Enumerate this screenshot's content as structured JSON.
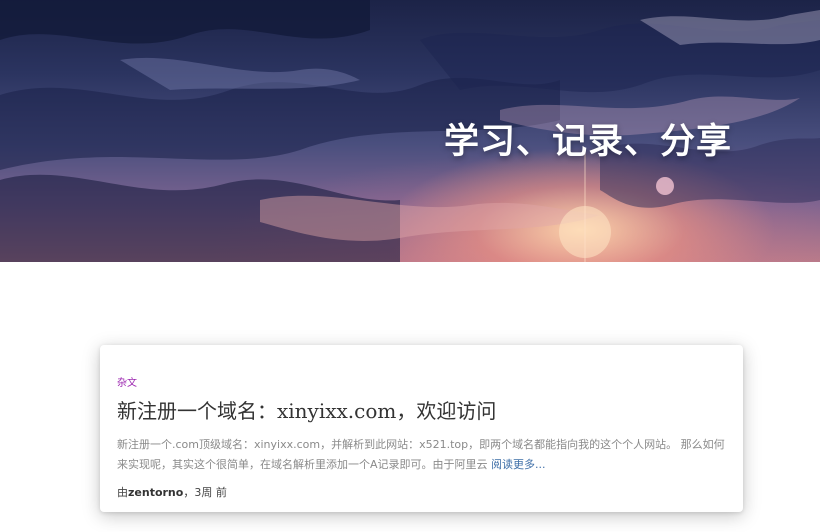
{
  "hero": {
    "title": "学习、记录、分享",
    "background_colors": [
      "#1c2347",
      "#4a4f7e",
      "#b57b8a",
      "#ffd6aa"
    ]
  },
  "post": {
    "category": "杂文",
    "category_color": "#9c27b0",
    "title": "新注册一个域名：xinyixx.com，欢迎访问",
    "excerpt": "新注册一个.com顶级域名：xinyixx.com，并解析到此网站：x521.top，即两个域名都能指向我的这个个人网站。 那么如何来实现呢，其实这个很简单，在域名解析里添加一个A记录即可。由于阿里云",
    "read_more": "阅读更多...",
    "meta_prefix": "由",
    "author": "zentorno",
    "time_ago": "，3周 前"
  }
}
